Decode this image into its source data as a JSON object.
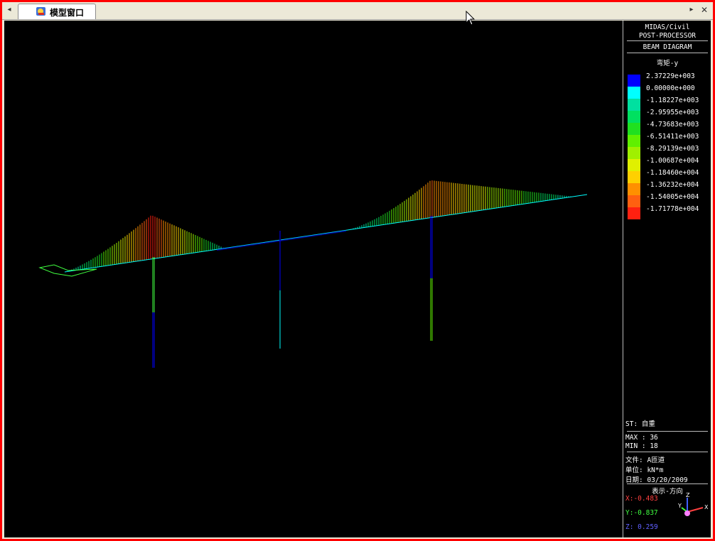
{
  "tab": {
    "title": "模型窗口",
    "icon": "model-window-icon",
    "nav_left": "◂",
    "nav_right": "▸",
    "close": "✕"
  },
  "panel": {
    "header1": "MIDAS/Civil",
    "header2": "POST-PROCESSOR",
    "header3": "BEAM DIAGRAM",
    "component": "弯矩-y",
    "legend": [
      {
        "value": "2.37229e+003",
        "color": "#0000ff"
      },
      {
        "value": "0.00000e+000",
        "color": "#00ffff"
      },
      {
        "value": "-1.18227e+003",
        "color": "#00e0a0"
      },
      {
        "value": "-2.95955e+003",
        "color": "#00e060"
      },
      {
        "value": "-4.73683e+003",
        "color": "#20e020"
      },
      {
        "value": "-6.51411e+003",
        "color": "#60f000"
      },
      {
        "value": "-8.29139e+003",
        "color": "#a0f000"
      },
      {
        "value": "-1.00687e+004",
        "color": "#e0f000"
      },
      {
        "value": "-1.18460e+004",
        "color": "#ffd000"
      },
      {
        "value": "-1.36232e+004",
        "color": "#ff9000"
      },
      {
        "value": "-1.54005e+004",
        "color": "#ff6010"
      },
      {
        "value": "-1.71778e+004",
        "color": "#ff2010"
      }
    ],
    "st": "ST: 自重",
    "max": "MAX : 36",
    "min": "MIN : 18",
    "file": "文件: A匝道",
    "unit": "单位: kN*m",
    "date": "日期: 03/20/2009",
    "view_dir": "表示-方向",
    "x": "X:-0.483",
    "y": "Y:-0.837",
    "z": "Z: 0.259",
    "axis_x": "X",
    "axis_y": "Y",
    "axis_z": "Z",
    "colors": {
      "x": "#ff4040",
      "y": "#40ff40",
      "z": "#6060ff"
    }
  }
}
